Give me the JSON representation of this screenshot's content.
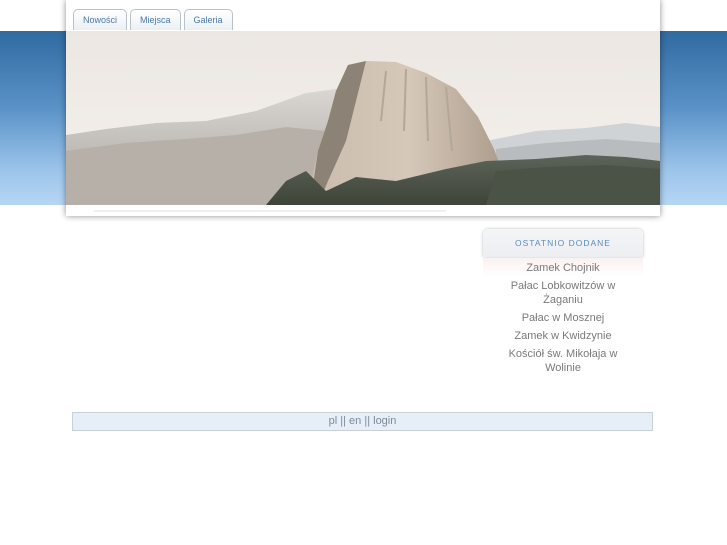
{
  "nav": {
    "tabs": [
      {
        "label": "Nowości"
      },
      {
        "label": "Miejsca"
      },
      {
        "label": "Galeria"
      }
    ]
  },
  "banner": {
    "scene": "mountain-landscape-photo"
  },
  "sidebar": {
    "title": "OSTATNIO DODANE",
    "items": [
      {
        "label": "Zamek Chojnik"
      },
      {
        "label": "Pałac Lobkowitzów w Żaganiu"
      },
      {
        "label": "Pałac w Mosznej"
      },
      {
        "label": "Zamek w Kwidzynie"
      },
      {
        "label": "Kościół św. Mikołaja w Wolinie"
      }
    ]
  },
  "footer": {
    "lang_pl": "pl",
    "sep1": "||",
    "lang_en": "en",
    "sep2": "||",
    "login": "login"
  },
  "colors": {
    "accent": "#5a8cc0",
    "band_top": "#2f6aa0",
    "band_bottom": "#b6d6f4"
  }
}
